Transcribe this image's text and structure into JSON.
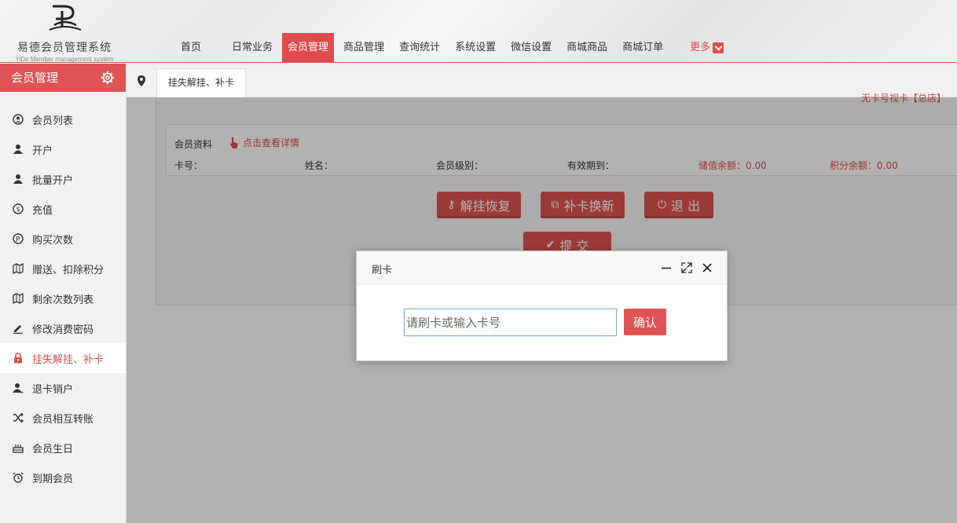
{
  "logo": {
    "title": "易德会员管理系统",
    "subtitle": "YiDe Member management system"
  },
  "nav": {
    "items": [
      "首页",
      "日常业务",
      "会员管理",
      "商品管理",
      "查询统计",
      "系统设置",
      "微信设置",
      "商城商品",
      "商城订单"
    ],
    "active": "会员管理",
    "more": "更多"
  },
  "sidebar": {
    "title": "会员管理",
    "items": [
      {
        "label": "会员列表",
        "icon": "user-circle-icon"
      },
      {
        "label": "开户",
        "icon": "user-icon"
      },
      {
        "label": "批量开户",
        "icon": "user-icon"
      },
      {
        "label": "充值",
        "icon": "coin-icon"
      },
      {
        "label": "购买次数",
        "icon": "ruble-icon"
      },
      {
        "label": "赠送、扣除积分",
        "icon": "map-icon"
      },
      {
        "label": "剩余次数列表",
        "icon": "map-icon"
      },
      {
        "label": "修改消费密码",
        "icon": "pencil-icon"
      },
      {
        "label": "挂失解挂、补卡",
        "icon": "lock-icon",
        "active": true
      },
      {
        "label": "退卡销户",
        "icon": "user-remove-icon"
      },
      {
        "label": "会员相互转账",
        "icon": "shuffle-icon"
      },
      {
        "label": "会员生日",
        "icon": "cake-icon"
      },
      {
        "label": "到期会员",
        "icon": "alarm-icon"
      }
    ]
  },
  "tab": {
    "label": "挂失解挂、补卡"
  },
  "corner_link": "无卡号视卡【总店】",
  "member": {
    "title": "会员资料",
    "detail_link": "点击查看详情",
    "card_no_label": "卡号：",
    "name_label": "姓名：",
    "level_label": "会员级别：",
    "expiry_label": "有效期到：",
    "stored_balance": "储值余额：0.00",
    "points_balance": "积分余额：0.00"
  },
  "actions": {
    "unlock": "解挂恢复",
    "reissue": "补卡换新",
    "exit": "退 出",
    "submit": "提 交"
  },
  "dialog": {
    "title": "刷卡",
    "placeholder": "请刷卡或输入卡号",
    "confirm": "确认"
  },
  "colors": {
    "accent": "#e05454",
    "overlay": "rgba(0,0,0,0.3)"
  }
}
